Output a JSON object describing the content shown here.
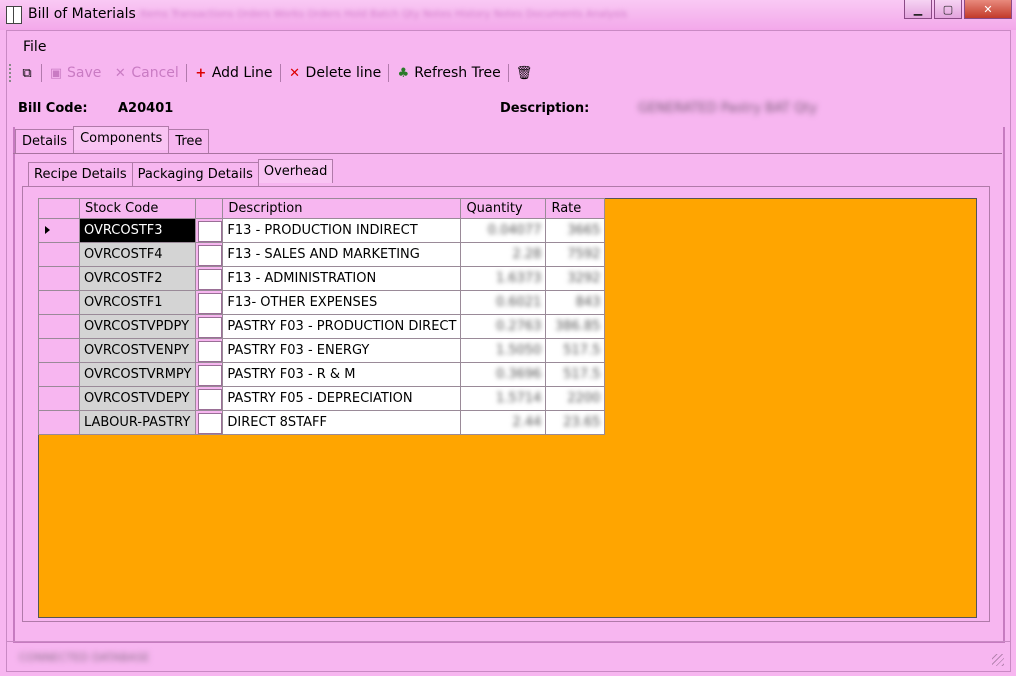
{
  "window": {
    "title": "Bill of Materials",
    "background_menu_blurred": "Items  Transactions  Orders  Works Orders  Hold  Batch Qty  Notes  History Notes  Documents  Analysis",
    "colors": {
      "accent_pink": "#f7b6f0",
      "grid_bg": "#ffa500",
      "selected_cell": "#000000"
    }
  },
  "menu": {
    "file": "File"
  },
  "toolbar": {
    "save": "Save",
    "cancel": "Cancel",
    "add_line": "Add Line",
    "delete_line": "Delete line",
    "refresh_tree": "Refresh Tree"
  },
  "header": {
    "bill_code_label": "Bill Code:",
    "bill_code_value": "A20401",
    "description_label": "Description:",
    "description_value": "GENERATED Pastry BAT Qty"
  },
  "tabs_outer": [
    "Details",
    "Components",
    "Tree"
  ],
  "tabs_inner": [
    "Recipe Details",
    "Packaging Details",
    "Overhead"
  ],
  "grid": {
    "columns": [
      "Stock Code",
      "",
      "Description",
      "Quantity",
      "Rate"
    ],
    "rows": [
      {
        "code": "OVRCOSTF3",
        "desc": "F13 - PRODUCTION INDIRECT",
        "qty": "0.04077",
        "rate": "3665"
      },
      {
        "code": "OVRCOSTF4",
        "desc": "F13 - SALES AND MARKETING",
        "qty": "2.28",
        "rate": "7592"
      },
      {
        "code": "OVRCOSTF2",
        "desc": "F13 - ADMINISTRATION",
        "qty": "1.6373",
        "rate": "3292"
      },
      {
        "code": "OVRCOSTF1",
        "desc": "F13- OTHER EXPENSES",
        "qty": "0.6021",
        "rate": "843"
      },
      {
        "code": "OVRCOSTVPDPY",
        "desc": "PASTRY F03 - PRODUCTION DIRECT",
        "qty": "0.2763",
        "rate": "386.85"
      },
      {
        "code": "OVRCOSTVENPY",
        "desc": "PASTRY F03 - ENERGY",
        "qty": "1.5050",
        "rate": "517.5"
      },
      {
        "code": "OVRCOSTVRMPY",
        "desc": "PASTRY F03 - R & M",
        "qty": "0.3696",
        "rate": "517.5"
      },
      {
        "code": "OVRCOSTVDEPY",
        "desc": "PASTRY F05 - DEPRECIATION",
        "qty": "1.5714",
        "rate": "2200"
      },
      {
        "code": "LABOUR-PASTRY",
        "desc": "DIRECT 8STAFF",
        "qty": "2.44",
        "rate": "23.65"
      }
    ]
  },
  "status": {
    "text": "CONNECTED DATABASE"
  }
}
